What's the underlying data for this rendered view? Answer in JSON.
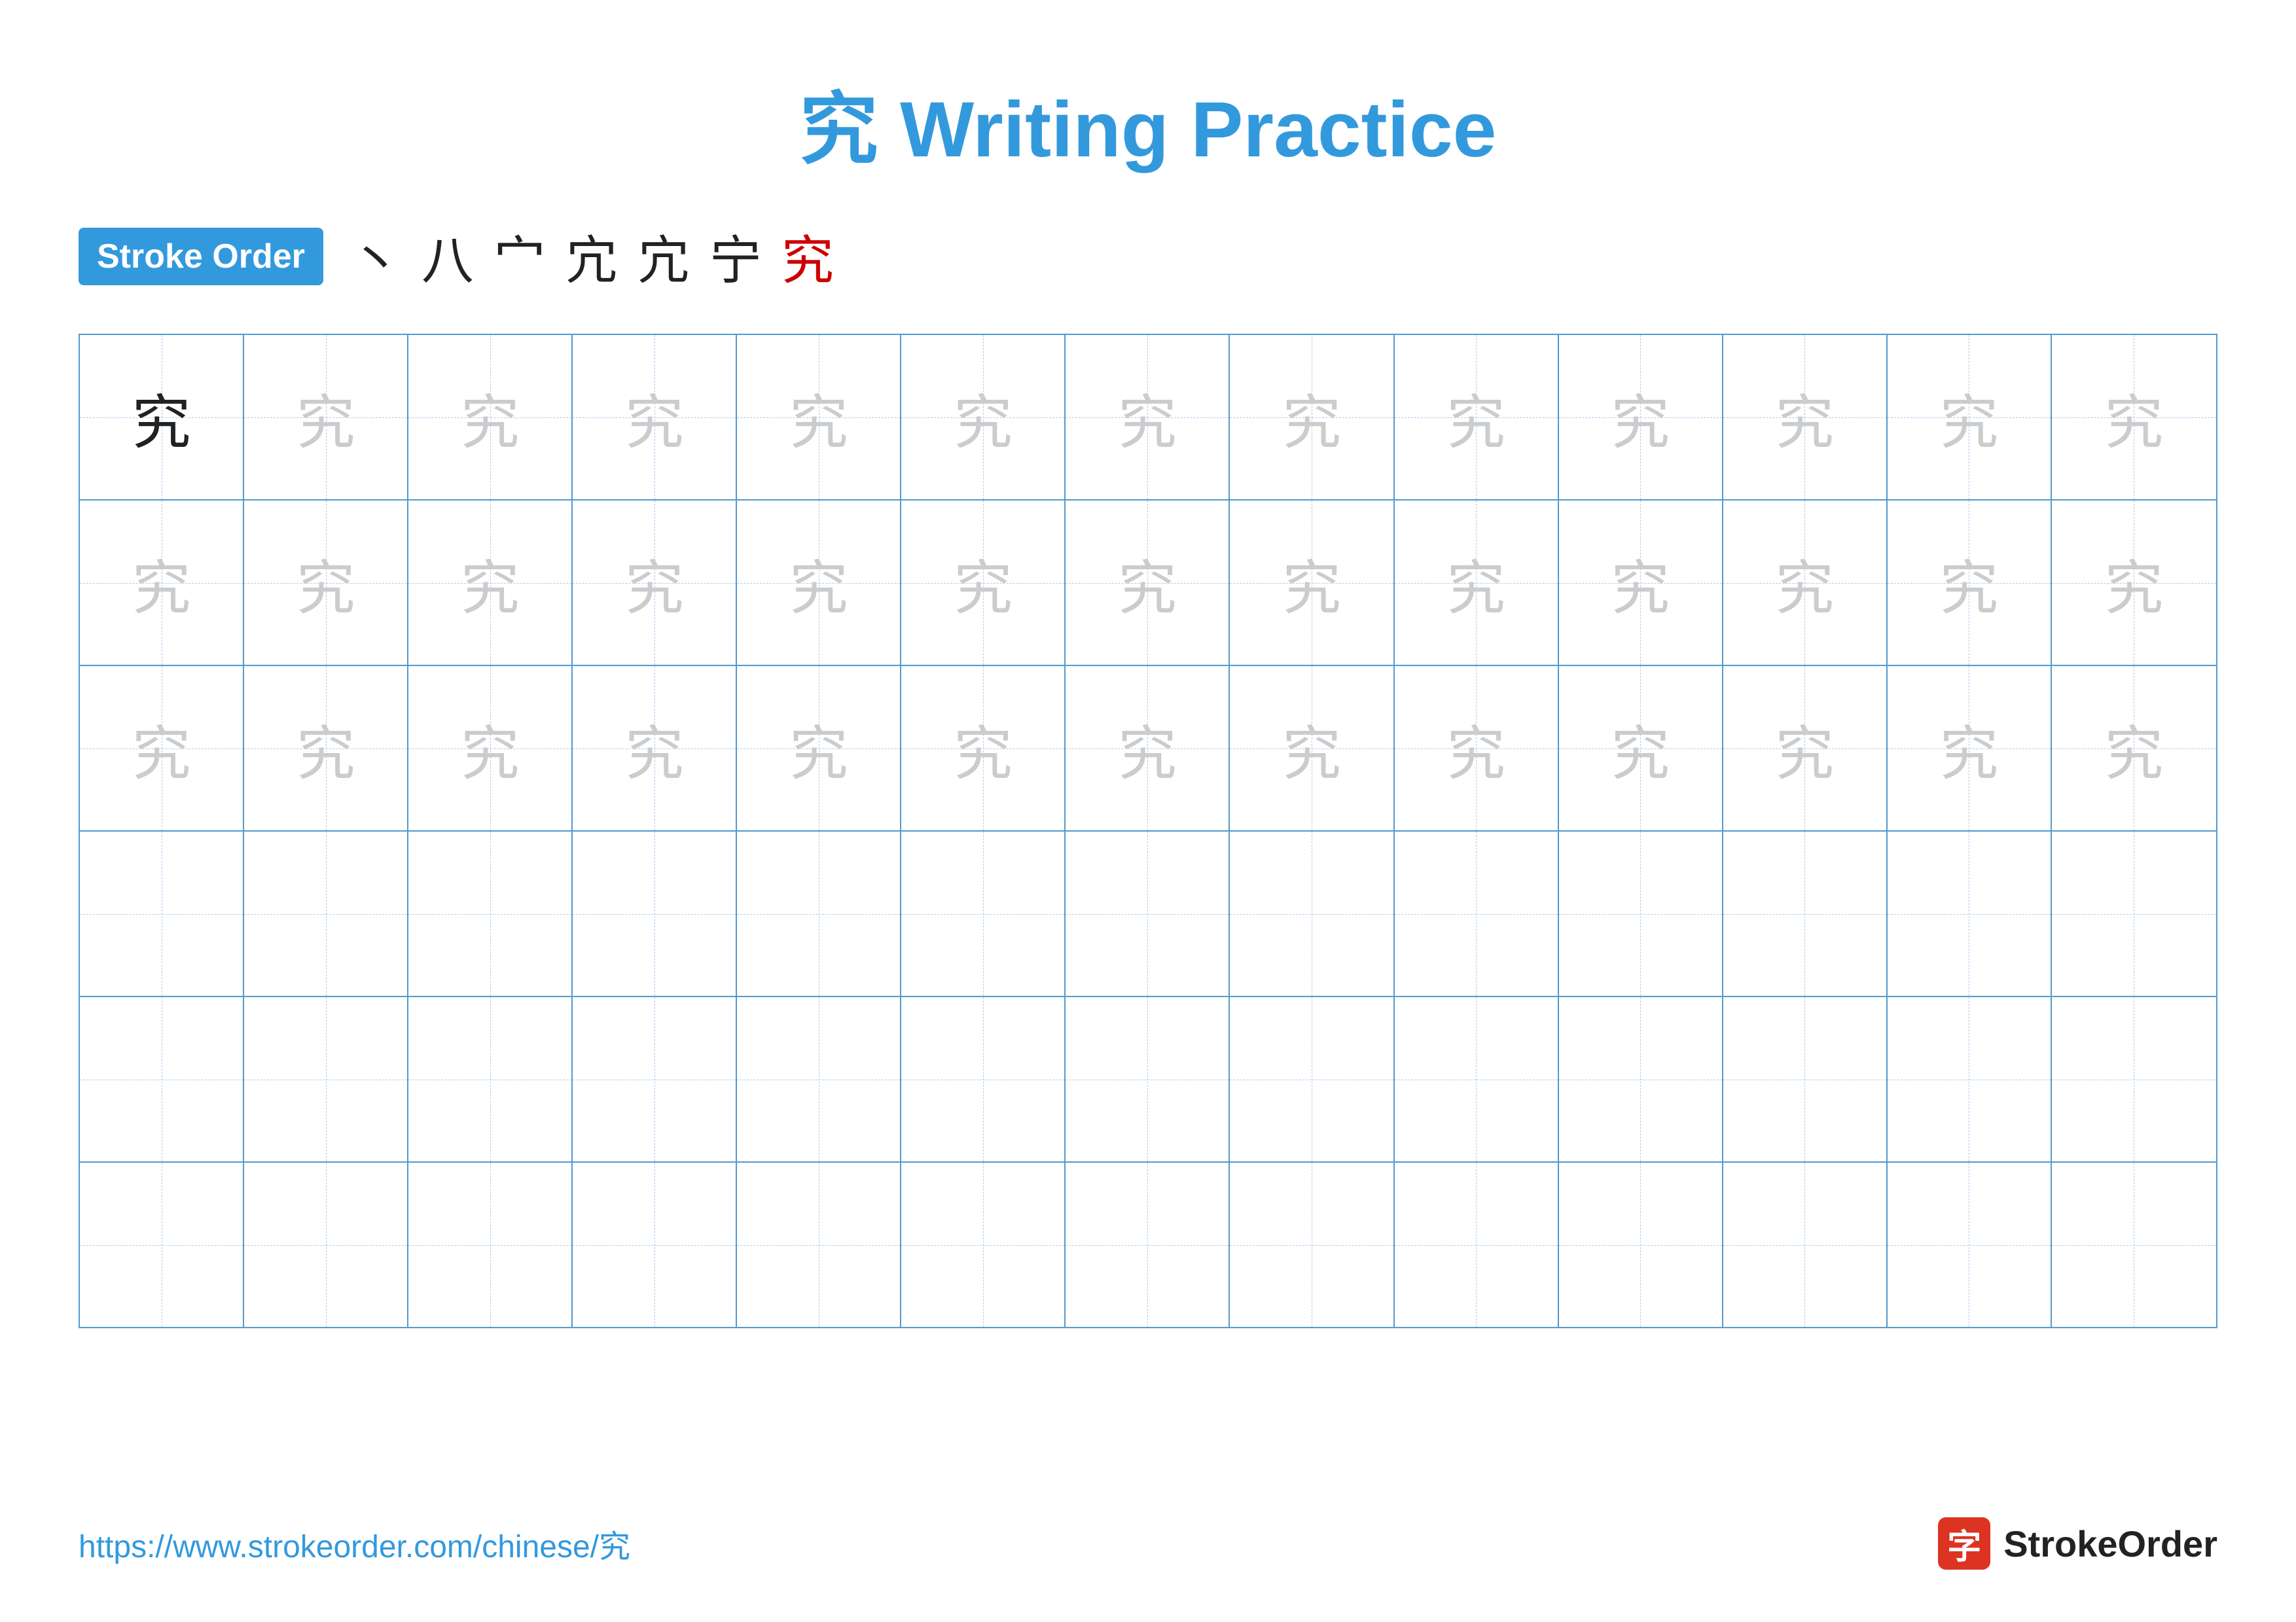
{
  "title": "究 Writing Practice",
  "stroke_order_badge": "Stroke Order",
  "stroke_sequence": [
    "丶",
    "八",
    "宀",
    "宂",
    "宂",
    "宁",
    "究"
  ],
  "char": "究",
  "rows": [
    {
      "type": "practice",
      "cells": [
        "dark",
        "light",
        "light",
        "light",
        "light",
        "light",
        "light",
        "light",
        "light",
        "light",
        "light",
        "light",
        "light"
      ]
    },
    {
      "type": "practice",
      "cells": [
        "light",
        "light",
        "light",
        "light",
        "light",
        "light",
        "light",
        "light",
        "light",
        "light",
        "light",
        "light",
        "light"
      ]
    },
    {
      "type": "practice",
      "cells": [
        "light",
        "light",
        "light",
        "light",
        "light",
        "light",
        "light",
        "light",
        "light",
        "light",
        "light",
        "light",
        "light"
      ]
    },
    {
      "type": "empty"
    },
    {
      "type": "empty"
    },
    {
      "type": "empty"
    }
  ],
  "footer": {
    "url": "https://www.strokeorder.com/chinese/究",
    "logo_char": "字",
    "logo_text": "StrokeOrder"
  }
}
